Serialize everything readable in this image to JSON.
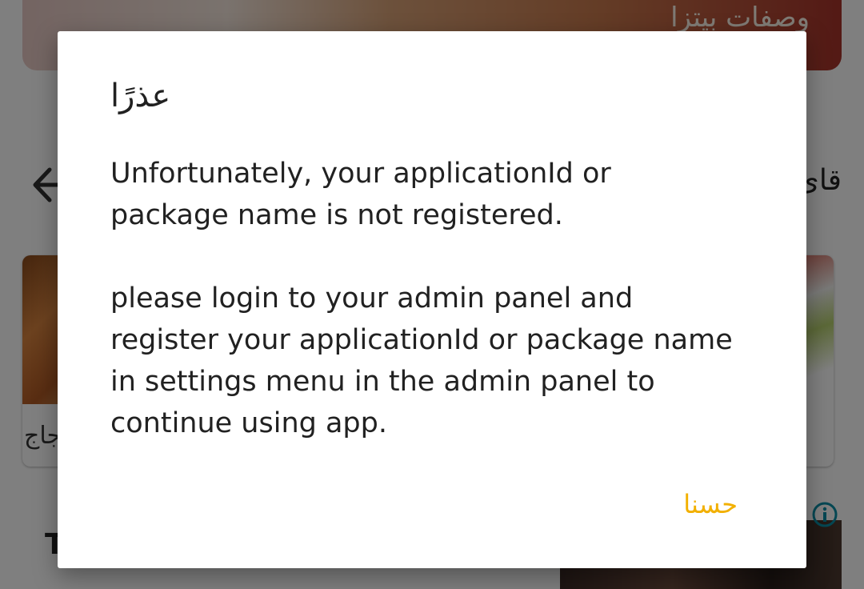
{
  "background": {
    "banner_title": "وصفات بيتزا",
    "section_title": "قائ",
    "left_card_caption": "جاج",
    "partial_heading": "T"
  },
  "dialog": {
    "title": "عذرًا",
    "message_paragraph_1": "Unfortunately, your applicationId or package name is not registered.",
    "message_paragraph_2": "please login to your admin panel and register your applicationId or package name in settings menu in the admin panel to continue using app.",
    "ok_button_label": "حسنا"
  },
  "colors": {
    "accent": "#f2b000",
    "info_icon": "#0a8fa6",
    "scrim": "#000000"
  }
}
